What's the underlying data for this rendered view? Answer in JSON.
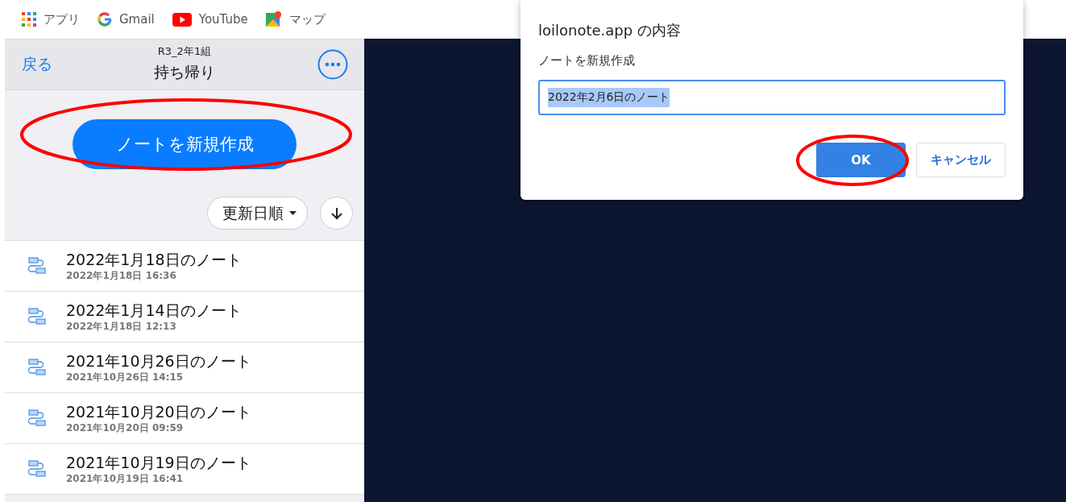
{
  "bookmarks": [
    {
      "kind": "apps",
      "label": "アプリ"
    },
    {
      "kind": "gmail",
      "label": "Gmail"
    },
    {
      "kind": "youtube",
      "label": "YouTube"
    },
    {
      "kind": "maps",
      "label": "マップ"
    }
  ],
  "header": {
    "back": "戻る",
    "subtitle": "R3_2年1組",
    "title": "持ち帰り"
  },
  "new_note_button": {
    "label": "ノートを新規作成",
    "highlight": true
  },
  "sort": {
    "label": "更新日順"
  },
  "notes": [
    {
      "title": "2022年1月18日のノート",
      "date": "2022年1月18日 16:36"
    },
    {
      "title": "2022年1月14日のノート",
      "date": "2022年1月18日 12:13"
    },
    {
      "title": "2021年10月26日のノート",
      "date": "2021年10月26日 14:15"
    },
    {
      "title": "2021年10月20日のノート",
      "date": "2021年10月20日 09:59"
    },
    {
      "title": "2021年10月19日のノート",
      "date": "2021年10月19日 16:41"
    }
  ],
  "dialog": {
    "title": "loilonote.app の内容",
    "message": "ノートを新規作成",
    "input": {
      "value": "2022年2月6日のノート",
      "selected": true
    },
    "buttons": [
      {
        "kind": "primary",
        "label": "OK",
        "highlight": true
      },
      {
        "kind": "secondary",
        "label": "キャンセル",
        "highlight": false
      }
    ]
  }
}
